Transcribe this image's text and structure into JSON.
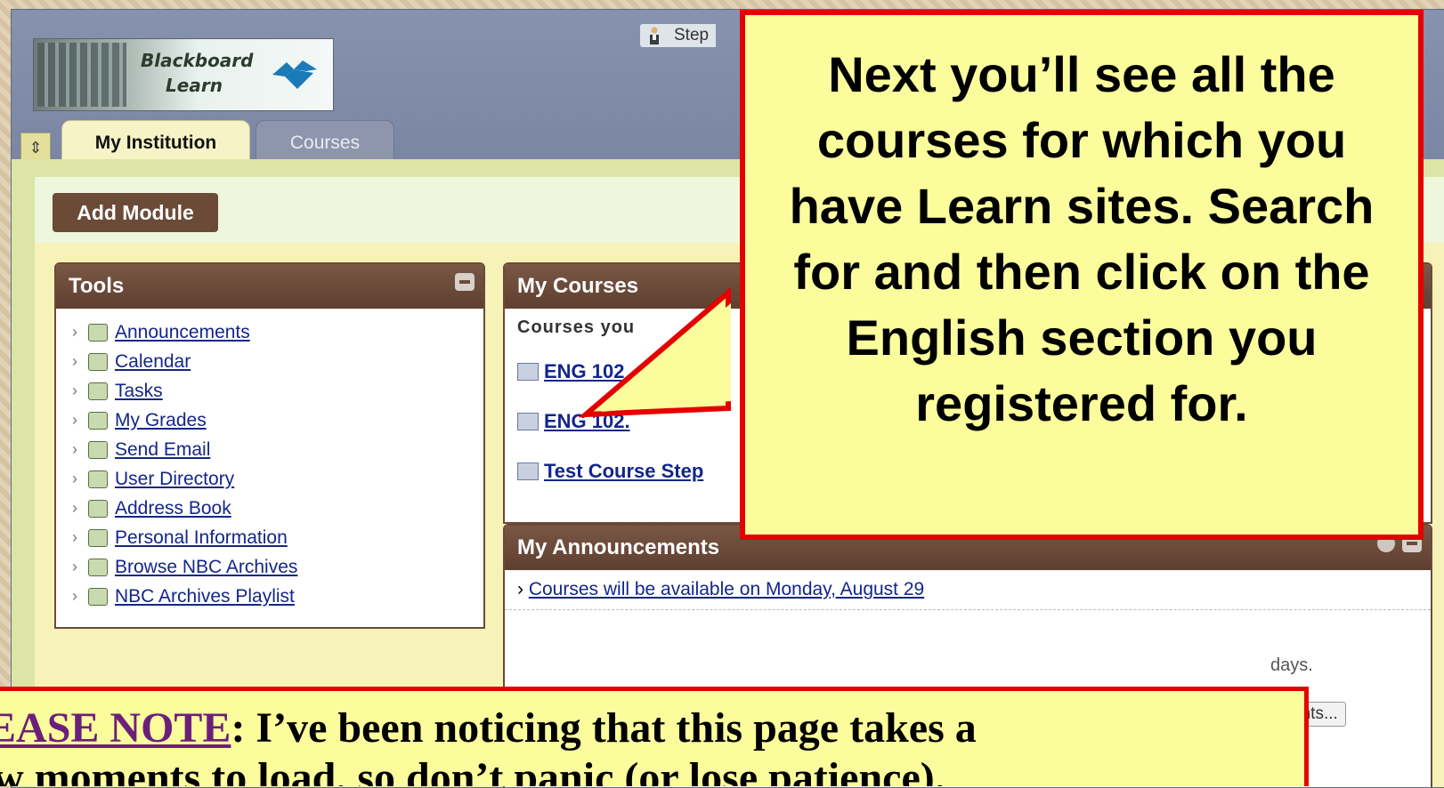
{
  "colors": {
    "callout_fill": "#fbfd9c",
    "callout_border": "#e50000",
    "module_header": "#6b4a38",
    "link": "#13268a"
  },
  "logo": {
    "line1": "Blackboard",
    "line2": "Learn"
  },
  "user": {
    "name": "Step"
  },
  "tabs": [
    {
      "label": "My Institution",
      "active": true
    },
    {
      "label": "Courses",
      "active": false
    }
  ],
  "add_module_label": "Add Module",
  "tools": {
    "title": "Tools",
    "items": [
      {
        "label": "Announcements",
        "icon": "megaphone-icon"
      },
      {
        "label": "Calendar",
        "icon": "calendar-icon"
      },
      {
        "label": "Tasks",
        "icon": "clipboard-icon"
      },
      {
        "label": "My Grades",
        "icon": "grades-icon"
      },
      {
        "label": "Send Email",
        "icon": "envelope-icon"
      },
      {
        "label": "User Directory",
        "icon": "directory-icon"
      },
      {
        "label": "Address Book",
        "icon": "address-book-icon"
      },
      {
        "label": "Personal Information",
        "icon": "personal-info-icon"
      },
      {
        "label": "Browse NBC Archives",
        "icon": "camera-icon"
      },
      {
        "label": "NBC Archives Playlist",
        "icon": "playlist-icon"
      }
    ]
  },
  "my_courses": {
    "title": "My Courses",
    "subheading": "Courses you",
    "items": [
      "ENG 102",
      "ENG 102.",
      "Test Course Step"
    ]
  },
  "my_announcements": {
    "title": "My Announcements",
    "item": "Courses will be available on Monday, August 29",
    "days_text": "days.",
    "more_label": "uncements..."
  },
  "callout": {
    "text": "Next you’ll see all the courses for which you have Learn sites. Search for and then click on the English section you registered for."
  },
  "note": {
    "label": "LEASE NOTE",
    "text": ":  I’ve been noticing that this page takes a",
    "line2": "w moments to load, so don’t panic (or lose patience)."
  }
}
